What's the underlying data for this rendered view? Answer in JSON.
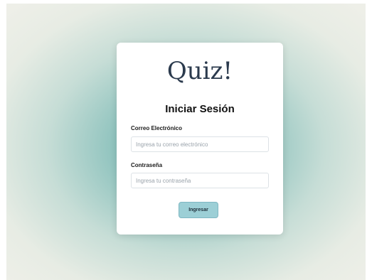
{
  "app": {
    "logo": "Quiz!"
  },
  "login": {
    "heading": "Iniciar Sesión",
    "email": {
      "label": "Correo Electrónico",
      "placeholder": "Ingresa tu correo electrónico",
      "value": ""
    },
    "password": {
      "label": "Contraseña",
      "placeholder": "Ingresa tu contraseña",
      "value": ""
    },
    "submit_label": "Ingresar"
  },
  "colors": {
    "background_center": "#6fb3ae",
    "background_edge": "#eeefe8",
    "card": "#ffffff",
    "logo_text": "#2b3a4d",
    "button": "#9ccfd6"
  }
}
